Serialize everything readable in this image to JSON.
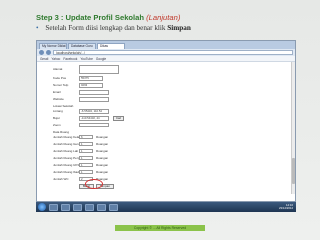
{
  "slide": {
    "title": "Step 3 : Update Profil Sekolah",
    "title_sub": "(Lanjutan)",
    "bullet_text": "Setelah Form diisi lengkap dan benar klik ",
    "bullet_bold": "Simpan"
  },
  "browser": {
    "tabs": [
      "My Nomor Diklat",
      "Database Guru",
      "Dikas"
    ],
    "url": "localhost/sekolah/.../",
    "bookmarks": [
      "Gmail",
      "Yahoo",
      "Facebook",
      "YouTube",
      "Google"
    ]
  },
  "form": {
    "rows": [
      {
        "label": "Alamat",
        "value": "",
        "type": "textarea"
      },
      {
        "label": "Kode Pos",
        "value": "55375",
        "type": "input",
        "w": "w24"
      },
      {
        "label": "Nomor Telp",
        "value": "0293",
        "type": "input",
        "w": "w24"
      },
      {
        "label": "Email",
        "value": "",
        "type": "input",
        "w": "w30"
      },
      {
        "label": "Website",
        "value": "",
        "type": "input",
        "w": "w30"
      }
    ],
    "map_subhead": "Lokasi Sekolah",
    "map_rows": [
      {
        "label": "Lintang",
        "value": "-6.55432, 110.54",
        "w": "w30"
      },
      {
        "label": "Bujur",
        "value": "-110.54432, 44",
        "w": "w30",
        "btn": "Cari"
      },
      {
        "label": "Zoom",
        "value": "",
        "w": "w30"
      }
    ],
    "room_subhead": "Data Ruang",
    "room_rows": [
      {
        "label": "Jumlah Ruang Kelas",
        "value": "6",
        "unit": "Ruangan"
      },
      {
        "label": "Jumlah Ruang Guru",
        "value": "1",
        "unit": "Ruangan"
      },
      {
        "label": "Jumlah Ruang Lab",
        "value": "1",
        "unit": "Ruangan"
      },
      {
        "label": "Jumlah Ruang Perpus",
        "value": "1",
        "unit": "Ruangan"
      },
      {
        "label": "Jumlah Ruang UKS",
        "value": "1",
        "unit": "Ruangan"
      },
      {
        "label": "Jumlah Ruang Ibadah",
        "value": "1",
        "unit": "Ruangan"
      },
      {
        "label": "Jumlah WC",
        "value": "2",
        "unit": "Ruangan"
      }
    ],
    "batal_label": "Batal",
    "simpan_label": "Simpan"
  },
  "taskbar": {
    "time": "14:10",
    "date": "23/12/2012"
  },
  "footer": {
    "text": "Copyright © ... All Rights Reserved"
  }
}
